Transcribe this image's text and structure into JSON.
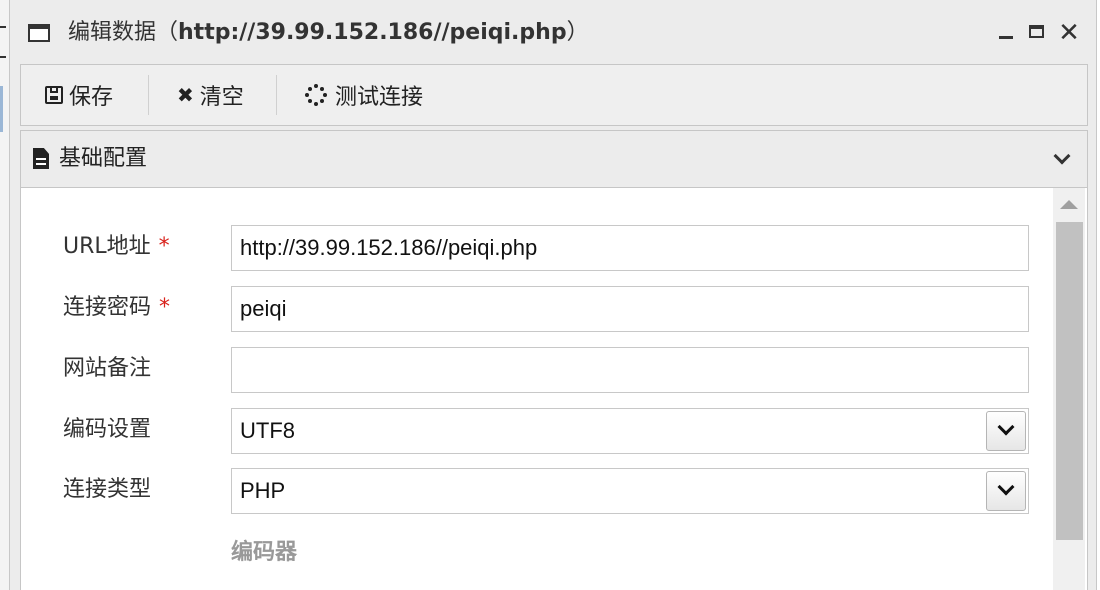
{
  "window": {
    "title_prefix": "编辑数据（",
    "title_url": "http://39.99.152.186//peiqi.php",
    "title_suffix": "）",
    "controls": {
      "close": "✕"
    }
  },
  "toolbar": {
    "save_label": "保存",
    "clear_label": "清空",
    "clear_icon": "✖",
    "test_label": "测试连接"
  },
  "panel": {
    "title": "基础配置"
  },
  "form": {
    "url": {
      "label": "URL地址",
      "required": "*",
      "value": "http://39.99.152.186//peiqi.php"
    },
    "password": {
      "label": "连接密码",
      "required": "*",
      "value": "peiqi"
    },
    "note": {
      "label": "网站备注",
      "value": ""
    },
    "encoding": {
      "label": "编码设置",
      "value": "UTF8"
    },
    "conn_type": {
      "label": "连接类型",
      "value": "PHP"
    },
    "encoder_label": "编码器"
  },
  "icons": {
    "window": "window-icon",
    "save": "floppy-icon",
    "clear": "x-icon",
    "test": "spinner-icon",
    "panel": "document-icon",
    "collapse": "chevron-down-icon"
  },
  "colors": {
    "required": "#d9221c",
    "muted_label": "#999999",
    "chrome_bg": "#ececec"
  }
}
